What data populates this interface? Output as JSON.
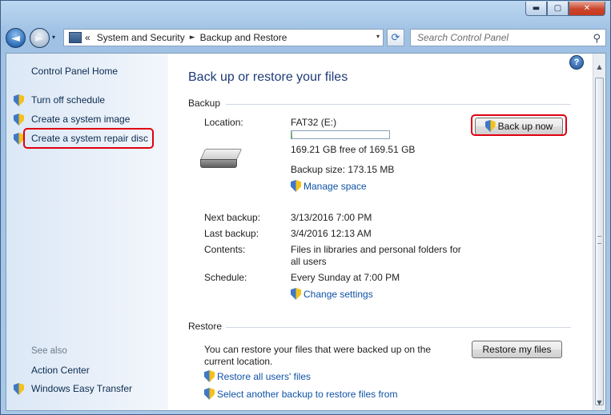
{
  "window": {
    "minimize_glyph": "▬",
    "maximize_glyph": "▢",
    "close_glyph": "✕"
  },
  "nav": {
    "back_glyph": "◄",
    "forward_glyph": "►",
    "recent_glyph": "▾",
    "address_prefix": "«",
    "breadcrumb": [
      "System and Security",
      "Backup and Restore"
    ],
    "breadcrumb_sep": "►",
    "address_dropdown_glyph": "▾",
    "refresh_glyph": "⟳",
    "search_placeholder": "Search Control Panel",
    "search_glyph": "⚲"
  },
  "sidebar": {
    "home": "Control Panel Home",
    "tasks": [
      "Turn off schedule",
      "Create a system image",
      "Create a system repair disc"
    ],
    "see_also_label": "See also",
    "see_also": [
      "Action Center",
      "Windows Easy Transfer"
    ]
  },
  "main": {
    "help_glyph": "?",
    "title": "Back up or restore your files",
    "backup": {
      "section": "Backup",
      "location_label": "Location:",
      "location_value": "FAT32 (E:)",
      "free_space": "169.21 GB free of 169.51 GB",
      "used_fraction": 0.002,
      "backup_size": "Backup size: 173.15 MB",
      "manage_space": "Manage space",
      "back_up_now": "Back up now",
      "next_backup_label": "Next backup:",
      "next_backup_value": "3/13/2016 7:00 PM",
      "last_backup_label": "Last backup:",
      "last_backup_value": "3/4/2016 12:13 AM",
      "contents_label": "Contents:",
      "contents_value_line1": "Files in libraries and personal folders for",
      "contents_value_line2": "all users",
      "schedule_label": "Schedule:",
      "schedule_value": "Every Sunday at 7:00 PM",
      "change_settings": "Change settings"
    },
    "restore": {
      "section": "Restore",
      "description_line1": "You can restore your files that were backed up on the",
      "description_line2": "current location.",
      "restore_my_files": "Restore my files",
      "restore_all_users": "Restore all users' files",
      "select_another": "Select another backup to restore files from"
    }
  },
  "scrollbar": {
    "up_glyph": "▲",
    "down_glyph": "▼"
  },
  "colors": {
    "highlight": "#e00010",
    "link": "#0f52a6",
    "title": "#1e3b78"
  }
}
